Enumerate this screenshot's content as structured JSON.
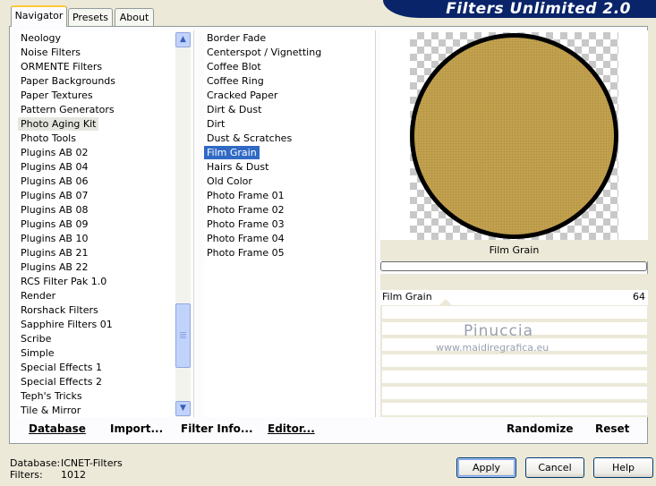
{
  "app": {
    "title": "Filters Unlimited 2.0"
  },
  "tabs": [
    {
      "label": "Navigator",
      "active": true
    },
    {
      "label": "Presets",
      "active": false
    },
    {
      "label": "About",
      "active": false
    }
  ],
  "categories": [
    "Neology",
    "Noise Filters",
    "ORMENTE Filters",
    "Paper Backgrounds",
    "Paper Textures",
    "Pattern Generators",
    "Photo Aging Kit",
    "Photo Tools",
    "Plugins AB 02",
    "Plugins AB 04",
    "Plugins AB 06",
    "Plugins AB 07",
    "Plugins AB 08",
    "Plugins AB 09",
    "Plugins AB 10",
    "Plugins AB 21",
    "Plugins AB 22",
    "RCS Filter Pak 1.0",
    "Render",
    "Rorshack Filters",
    "Sapphire Filters 01",
    "Scribe",
    "Simple",
    "Special Effects 1",
    "Special Effects 2",
    "Teph's Tricks",
    "Tile & Mirror"
  ],
  "selected_category": "Photo Aging Kit",
  "filters": [
    "Border Fade",
    "Centerspot / Vignetting",
    "Coffee Blot",
    "Coffee Ring",
    "Cracked Paper",
    "Dirt & Dust",
    "Dirt",
    "Dust & Scratches",
    "Film Grain",
    "Hairs & Dust",
    "Old Color",
    "Photo Frame 01",
    "Photo Frame 02",
    "Photo Frame 03",
    "Photo Frame 04",
    "Photo Frame 05"
  ],
  "selected_filter": "Film Grain",
  "preview": {
    "filter_name": "Film Grain",
    "disk_color": "#c7a551"
  },
  "parameter": {
    "label": "Film Grain",
    "value": "64"
  },
  "watermark": {
    "name": "Pinuccia",
    "url": "www.maidiregrafica.eu"
  },
  "panel_buttons": {
    "database": "Database",
    "import": "Import...",
    "filter_info": "Filter Info...",
    "editor": "Editor...",
    "randomize": "Randomize",
    "reset": "Reset"
  },
  "footer": {
    "database_label": "Database:",
    "database_value": "ICNET-Filters",
    "filters_label": "Filters:",
    "filters_value": "1012"
  },
  "dialog_buttons": {
    "apply": "Apply",
    "cancel": "Cancel",
    "help": "Help"
  },
  "colors": {
    "banner": "#0a246a",
    "selection": "#316ac5",
    "tab_highlight": "#ffc83c"
  }
}
